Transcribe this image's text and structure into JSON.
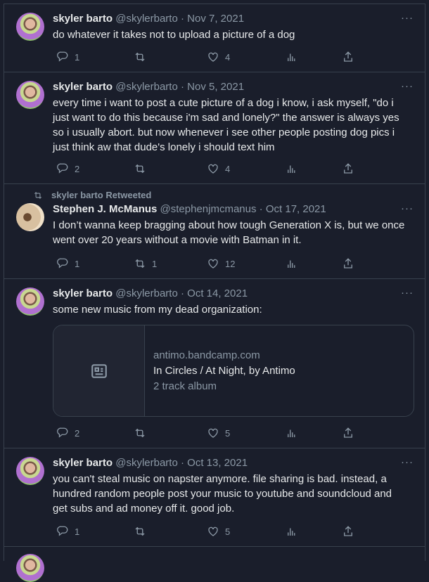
{
  "tweets": [
    {
      "name": "skyler barto",
      "handle": "@skylerbarto",
      "date": "Nov 7, 2021",
      "text": [
        "do whatever it takes not to upload a picture of a dog"
      ],
      "replies": "1",
      "retweets": "",
      "likes": "4"
    },
    {
      "name": "skyler barto",
      "handle": "@skylerbarto",
      "date": "Nov 5, 2021",
      "text": [
        "every time i want to post a cute picture of a dog i know, i ask myself, \"do i",
        "just want to do this because i'm sad and lonely?\" the answer is always yes",
        "so i usually abort. but now whenever i see other people posting dog pics i",
        "just think aw that dude's lonely i should text him"
      ],
      "replies": "2",
      "retweets": "",
      "likes": "4"
    },
    {
      "retweeted_by": "skyler barto Retweeted",
      "name": "Stephen J. McManus",
      "handle": "@stephenjmcmanus",
      "date": "Oct 17, 2021",
      "text": [
        "I don’t wanna keep bragging about how tough Generation X is, but we once",
        "went over 20 years without a movie with Batman in it."
      ],
      "replies": "1",
      "retweets": "1",
      "likes": "12"
    },
    {
      "name": "skyler barto",
      "handle": "@skylerbarto",
      "date": "Oct 14, 2021",
      "text": [
        "some new music from my dead organization:"
      ],
      "card": {
        "domain": "antimo.bandcamp.com",
        "title": "In Circles / At Night, by Antimo",
        "description": "2 track album"
      },
      "replies": "2",
      "retweets": "",
      "likes": "5"
    },
    {
      "name": "skyler barto",
      "handle": "@skylerbarto",
      "date": "Oct 13, 2021",
      "text": [
        "you can't steal music on napster anymore. file sharing is bad. instead, a",
        "hundred random people post your music to youtube and soundcloud and",
        "get subs and ad money off it. good job."
      ],
      "replies": "1",
      "retweets": "",
      "likes": "5"
    }
  ],
  "separator": "·",
  "more_label": "···",
  "colors": {
    "background": "#1a1e2b",
    "border": "#38414d",
    "muted": "#8b98a5",
    "text": "#e7e9ea"
  }
}
